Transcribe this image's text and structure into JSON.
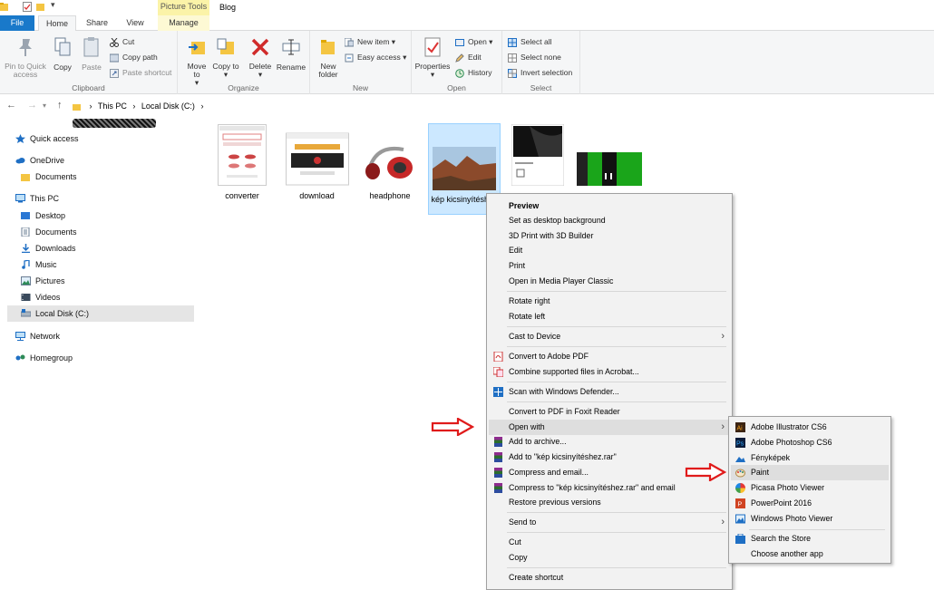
{
  "window": {
    "title": "Blog"
  },
  "tabs": {
    "file": "File",
    "home": "Home",
    "share": "Share",
    "view": "View",
    "manage": "Manage",
    "picture_tools": "Picture Tools"
  },
  "ribbon": {
    "clipboard": {
      "label": "Clipboard",
      "pin": "Pin to Quick access",
      "copy": "Copy",
      "paste": "Paste",
      "cut": "Cut",
      "copy_path": "Copy path",
      "paste_shortcut": "Paste shortcut"
    },
    "organize": {
      "label": "Organize",
      "move_to": "Move to",
      "copy_to": "Copy to",
      "delete": "Delete",
      "rename": "Rename"
    },
    "new": {
      "label": "New",
      "new_folder": "New folder",
      "new_item": "New item",
      "easy_access": "Easy access"
    },
    "open": {
      "label": "Open",
      "properties": "Properties",
      "open": "Open",
      "edit": "Edit",
      "history": "History"
    },
    "select": {
      "label": "Select",
      "select_all": "Select all",
      "select_none": "Select none",
      "invert": "Invert selection"
    }
  },
  "address": {
    "crumbs": [
      "This PC",
      "Local Disk (C:)"
    ]
  },
  "nav": {
    "quick_access": "Quick access",
    "onedrive": "OneDrive",
    "onedrive_docs": "Documents",
    "this_pc": "This PC",
    "desktop": "Desktop",
    "documents": "Documents",
    "downloads": "Downloads",
    "music": "Music",
    "pictures": "Pictures",
    "videos": "Videos",
    "local_disk": "Local Disk (C:)",
    "network": "Network",
    "homegroup": "Homegroup"
  },
  "files": [
    {
      "name": "converter"
    },
    {
      "name": "download"
    },
    {
      "name": "headphone"
    },
    {
      "name": "kép kicsinyítéshez"
    }
  ],
  "context_menu": {
    "preview": "Preview",
    "set_desktop_bg": "Set as desktop background",
    "print_3d": "3D Print with 3D Builder",
    "edit": "Edit",
    "print": "Print",
    "open_mpc": "Open in Media Player Classic",
    "rotate_right": "Rotate right",
    "rotate_left": "Rotate left",
    "cast": "Cast to Device",
    "convert_pdf": "Convert to Adobe PDF",
    "combine_acrobat": "Combine supported files in Acrobat...",
    "scan_defender": "Scan with Windows Defender...",
    "foxit": "Convert to PDF in Foxit Reader",
    "open_with": "Open with",
    "add_archive": "Add to archive...",
    "add_rar": "Add to \"kép kicsinyítéshez.rar\"",
    "compress_email": "Compress and email...",
    "compress_rar_email": "Compress to \"kép kicsinyítéshez.rar\" and email",
    "restore": "Restore previous versions",
    "send_to": "Send to",
    "cut": "Cut",
    "copy": "Copy",
    "create_shortcut": "Create shortcut"
  },
  "submenu": {
    "illustrator": "Adobe Illustrator CS6",
    "photoshop": "Adobe Photoshop CS6",
    "fenykepek": "Fényképek",
    "paint": "Paint",
    "picasa": "Picasa Photo Viewer",
    "powerpoint": "PowerPoint 2016",
    "wpv": "Windows Photo Viewer",
    "store": "Search the Store",
    "choose": "Choose another app"
  }
}
